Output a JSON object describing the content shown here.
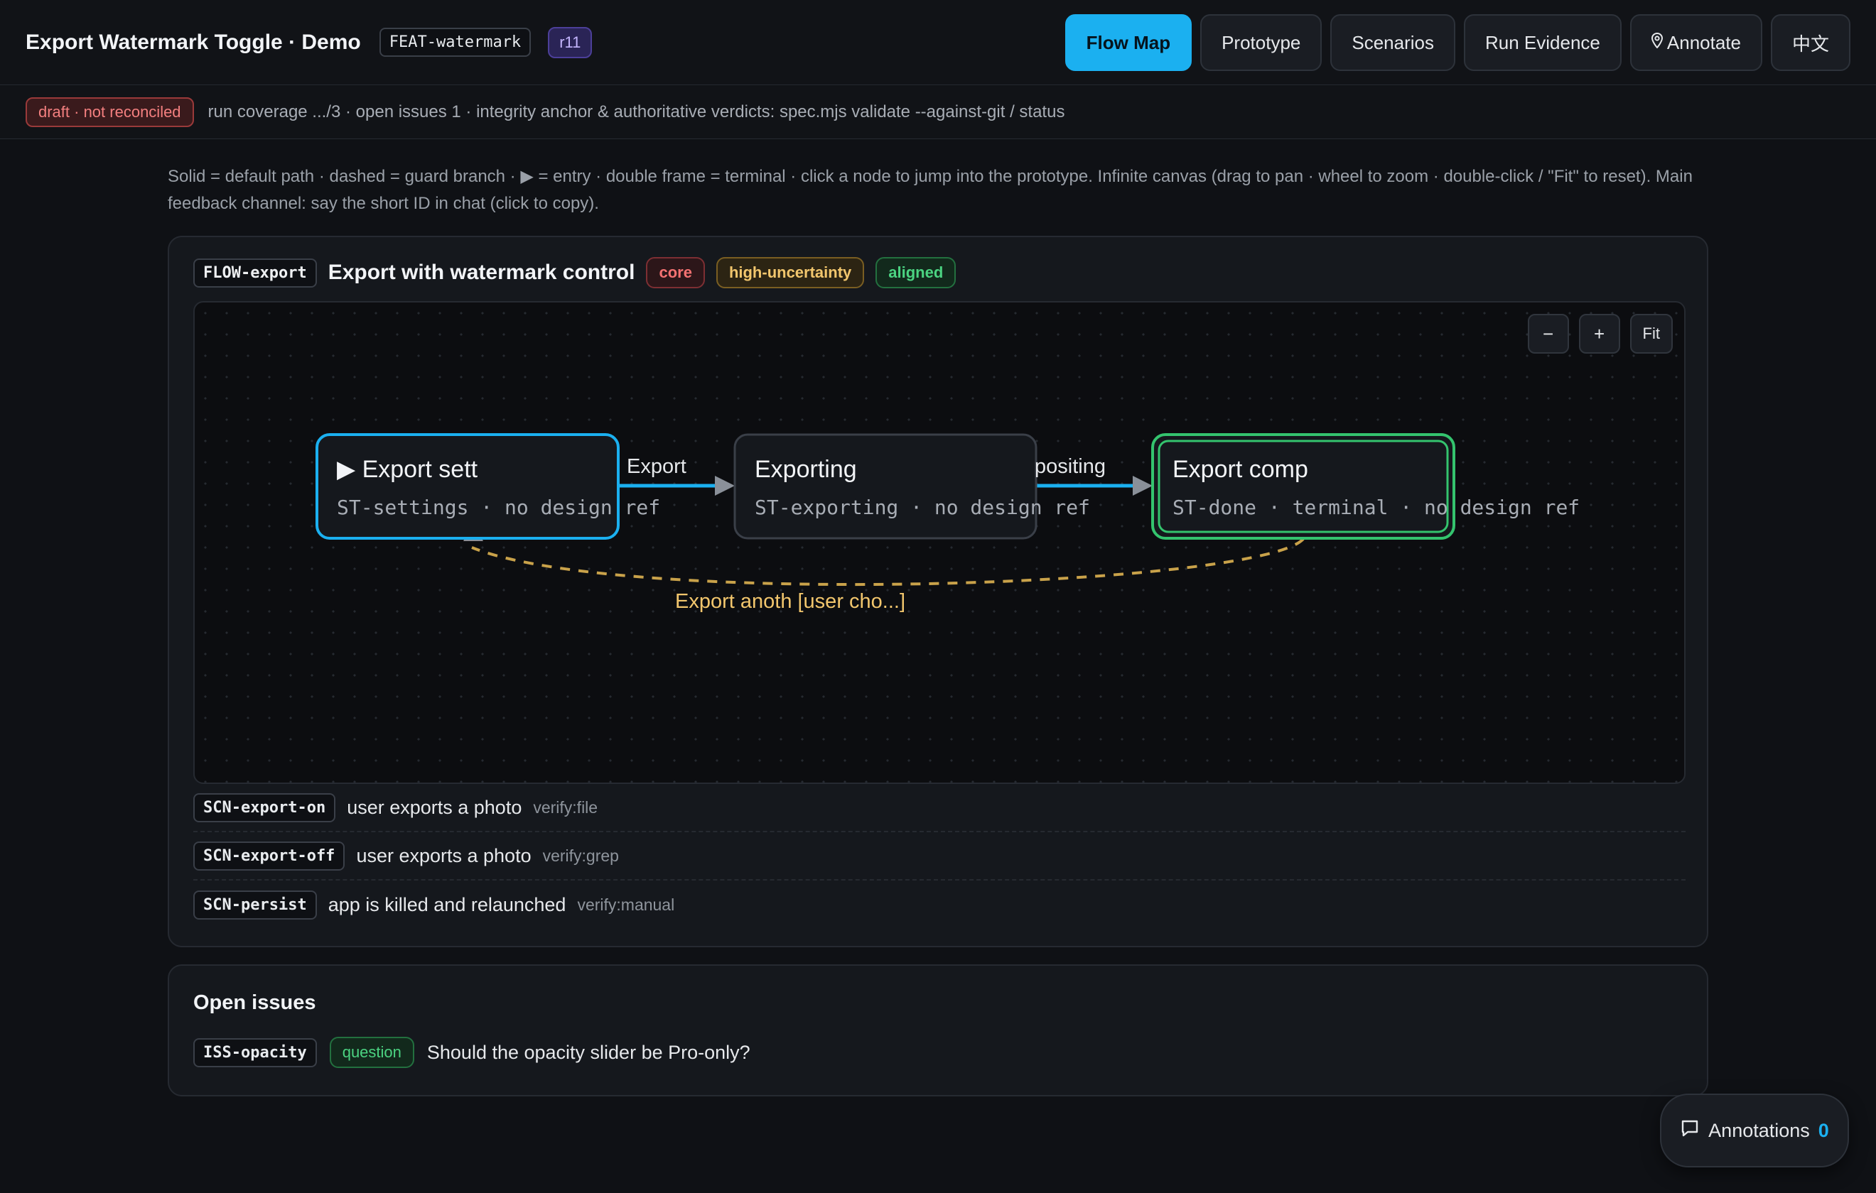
{
  "header": {
    "title": "Export Watermark Toggle · Demo",
    "feature_id": "FEAT-watermark",
    "revision": "r11",
    "nav": [
      {
        "label": "Flow Map",
        "active": true
      },
      {
        "label": "Prototype"
      },
      {
        "label": "Scenarios"
      },
      {
        "label": "Run Evidence"
      },
      {
        "label": "Annotate",
        "icon": "map-pin-icon"
      },
      {
        "label": "中文"
      }
    ]
  },
  "status": {
    "badge": "draft · not reconciled",
    "text": "run coverage .../3 · open issues 1 · integrity anchor & authoritative verdicts: spec.mjs validate --against-git / status"
  },
  "legend": "Solid = default path · dashed = guard branch · ▶ = entry · double frame = terminal · click a node to jump into the prototype. Infinite canvas (drag to pan · wheel to zoom · double-click / \"Fit\" to reset). Main feedback channel: say the short ID in chat (click to copy).",
  "flow": {
    "id": "FLOW-export",
    "title": "Export with watermark control",
    "tags": [
      "core",
      "high-uncertainty",
      "aligned"
    ],
    "zoom": {
      "minus": "−",
      "plus": "+",
      "fit": "Fit"
    },
    "nodes": [
      {
        "title": "▶ Export sett",
        "sub": "ST-settings · no design ref"
      },
      {
        "title": "Exporting",
        "sub": "ST-exporting · no design ref"
      },
      {
        "title": "Export comp",
        "sub": "ST-done · terminal · no design ref"
      }
    ],
    "edges": [
      {
        "label": "Export"
      },
      {
        "label": "positing"
      },
      {
        "label": "Export anoth [user cho...]"
      }
    ],
    "colors": {
      "entry": "#1bb0f0",
      "terminal": "#34c46e",
      "guard": "#c9a24a",
      "edge": "#1bb0f0"
    },
    "scenarios": [
      {
        "id": "SCN-export-on",
        "text": "user exports a photo",
        "verify": "verify:file"
      },
      {
        "id": "SCN-export-off",
        "text": "user exports a photo",
        "verify": "verify:grep"
      },
      {
        "id": "SCN-persist",
        "text": "app is killed and relaunched",
        "verify": "verify:manual"
      }
    ]
  },
  "issues": {
    "title": "Open issues",
    "items": [
      {
        "id": "ISS-opacity",
        "type": "question",
        "text": "Should the opacity slider be Pro-only?"
      }
    ]
  },
  "annotations": {
    "label": "Annotations",
    "count": "0"
  }
}
